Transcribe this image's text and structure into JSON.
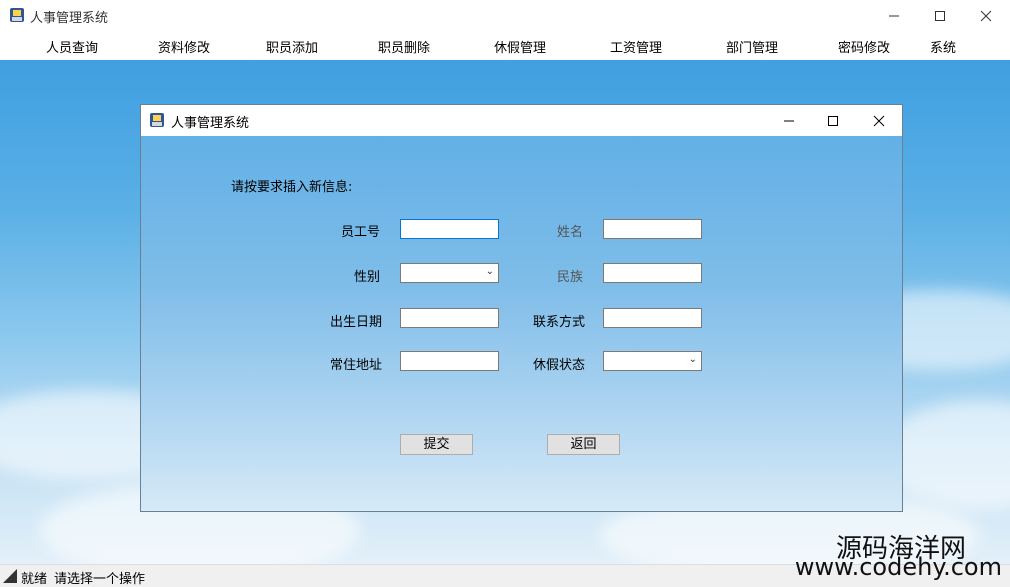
{
  "window": {
    "title": "人事管理系统"
  },
  "menu": [
    "人员查询",
    "资料修改",
    "职员添加",
    "职员删除",
    "休假管理",
    "工资管理",
    "部门管理",
    "密码修改",
    "系统"
  ],
  "dialog": {
    "title": "人事管理系统",
    "prompt": "请按要求插入新信息:",
    "fields": {
      "employee_id": {
        "label": "员工号",
        "value": ""
      },
      "name": {
        "label": "姓名",
        "value": ""
      },
      "gender": {
        "label": "性别",
        "value": ""
      },
      "ethnicity": {
        "label": "民族",
        "value": ""
      },
      "birth_date": {
        "label": "出生日期",
        "value": ""
      },
      "contact": {
        "label": "联系方式",
        "value": ""
      },
      "address": {
        "label": "常住地址",
        "value": ""
      },
      "leave_status": {
        "label": "休假状态",
        "value": ""
      }
    },
    "submit_label": "提交",
    "back_label": "返回"
  },
  "status": {
    "state": "就绪",
    "message": "请选择一个操作"
  },
  "watermark": {
    "brand": "源码海洋网",
    "url": "www.codehy.com"
  }
}
